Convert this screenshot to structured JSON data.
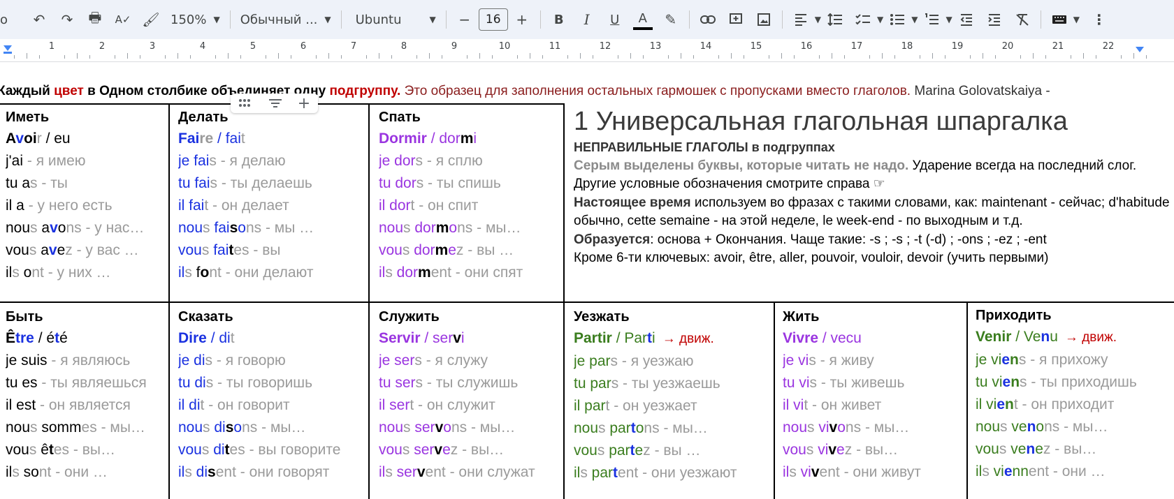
{
  "toolbar": {
    "partial_left": "o",
    "undo": "↶",
    "redo": "↷",
    "print": "🖶",
    "spell": "A✓",
    "paint": "🖌",
    "zoom": "150%",
    "style": "Обычный ...",
    "font": "Ubuntu",
    "font_size": "16",
    "minus": "−",
    "plus": "+",
    "bold": "B",
    "italic": "I",
    "underline": "U",
    "text_color": "A",
    "highlight": "✎",
    "more": "⋮"
  },
  "ruler": {
    "numbers": [
      "1",
      "2",
      "3",
      "4",
      "5",
      "6",
      "7",
      "8",
      "9",
      "10",
      "11",
      "12",
      "13",
      "14",
      "15",
      "16",
      "17",
      "18",
      "19",
      "20",
      "21",
      "22"
    ]
  },
  "headline": {
    "p1": "Каждый ",
    "p2": "цвет",
    "p3": " в Одном столбике объединяет одну ",
    "p4": "подгруппу.",
    "p5": " Это образец для заполнения остальных гармошек с пропусками вместо глаголов.",
    "p6": " Marina Golovatskaiya -"
  },
  "accent_colors": {
    "blue": "#1a31e0",
    "purple": "#9a35e0",
    "green": "#3a7d1e",
    "red": "#c00000",
    "gray": "#9a9a9a"
  },
  "verbs": {
    "avoir": {
      "title": "Иметь",
      "inf": [
        "A",
        "v",
        "oi",
        "r",
        " / eu"
      ],
      "lines": [
        [
          "j'ai",
          " - я имею"
        ],
        [
          "tu a",
          "s",
          " - ты"
        ],
        [
          "il a",
          " - у него есть"
        ],
        [
          "nou",
          "s",
          " a",
          "v",
          "o",
          "ns",
          " - у нас…"
        ],
        [
          "vou",
          "s",
          " a",
          "v",
          "e",
          "z",
          " - у вас …"
        ],
        [
          "il",
          "s",
          " o",
          "nt",
          " - у них …"
        ]
      ]
    },
    "faire": {
      "title": "Делать",
      "inf": [
        "Fai",
        "r",
        "e",
        " / fai",
        "t"
      ],
      "lines": [
        [
          "je fai",
          "s",
          " - я делаю"
        ],
        [
          "tu fai",
          "s",
          " - ты делаешь"
        ],
        [
          "il fai",
          "t",
          " - он делает"
        ],
        [
          "nou",
          "s",
          " fai",
          "s",
          "o",
          "ns",
          " - мы …"
        ],
        [
          "vou",
          "s",
          " fai",
          "t",
          "es",
          " - вы"
        ],
        [
          "il",
          "s",
          " f",
          "o",
          "nt",
          " - они делают"
        ]
      ]
    },
    "dormir": {
      "title": "Спать",
      "inf": [
        "Dormir",
        " / dor",
        "m",
        "i"
      ],
      "lines": [
        [
          "je dor",
          "s",
          " - я сплю"
        ],
        [
          "tu dor",
          "s",
          " - ты спишь"
        ],
        [
          "il dor",
          "t",
          " - он спит"
        ],
        [
          "nou",
          "s",
          " dor",
          "m",
          "o",
          "ns",
          " - мы…"
        ],
        [
          "vou",
          "s",
          " dor",
          "m",
          "e",
          "z",
          " - вы …"
        ],
        [
          "il",
          "s",
          " dor",
          "m",
          "ent",
          " - они спят"
        ]
      ]
    },
    "etre": {
      "title": "Быть",
      "inf": [
        "Ê",
        "tre",
        " / é",
        "t",
        "é"
      ],
      "lines": [
        [
          "je suis",
          " - я являюсь"
        ],
        [
          "tu es",
          " - ты являешься"
        ],
        [
          "il est",
          " - он является"
        ],
        [
          "nou",
          "s",
          " somm",
          "es",
          " - мы…"
        ],
        [
          "vou",
          "s",
          " ê",
          "t",
          "es",
          " - вы…"
        ],
        [
          "il",
          "s",
          " so",
          "nt",
          " - они …"
        ]
      ]
    },
    "dire": {
      "title": "Сказать",
      "inf": [
        "Dire",
        " / di",
        "t"
      ],
      "lines": [
        [
          "je di",
          "s",
          " - я говорю"
        ],
        [
          "tu di",
          "s",
          " - ты говоришь"
        ],
        [
          "il di",
          "t",
          " - он говорит"
        ],
        [
          "nou",
          "s",
          " di",
          "s",
          "o",
          "ns",
          " - мы…"
        ],
        [
          "vou",
          "s",
          " di",
          "t",
          "es",
          " - вы говорите"
        ],
        [
          "il",
          "s",
          " di",
          "s",
          "ent",
          " - они говорят"
        ]
      ]
    },
    "servir": {
      "title": "Служить",
      "inf": [
        "Servir",
        " / ser",
        "v",
        "i"
      ],
      "lines": [
        [
          "je ser",
          "s",
          " - я служу"
        ],
        [
          "tu ser",
          "s",
          " - ты служишь"
        ],
        [
          "il ser",
          "t",
          " - он служит"
        ],
        [
          "nou",
          "s",
          " ser",
          "v",
          "o",
          "ns",
          " - мы…"
        ],
        [
          "vou",
          "s",
          " ser",
          "v",
          "e",
          "z",
          " - вы…"
        ],
        [
          "il",
          "s",
          " ser",
          "v",
          "ent",
          " - они служат"
        ]
      ]
    },
    "partir": {
      "title": "Уезжать",
      "inf": [
        "Partir",
        " / Par",
        "t",
        "i"
      ],
      "arrow": "→ движ.",
      "lines": [
        [
          "je par",
          "s",
          " - я уезжаю"
        ],
        [
          "tu par",
          "s",
          " - ты уезжаешь"
        ],
        [
          "il par",
          "t",
          " - он уезжает"
        ],
        [
          "nou",
          "s",
          " par",
          "t",
          "o",
          "ns",
          " - мы…"
        ],
        [
          "vou",
          "s",
          " par",
          "t",
          "e",
          "z",
          " - вы …"
        ],
        [
          "il",
          "s",
          " par",
          "t",
          "ent",
          " - они уезжают"
        ]
      ]
    },
    "vivre": {
      "title": "Жить",
      "inf": [
        "Vivre",
        " / vecu"
      ],
      "lines": [
        [
          "je vi",
          "s",
          " - я живу"
        ],
        [
          "tu vi",
          "s",
          " - ты живешь"
        ],
        [
          "il vi",
          "t",
          " - он живет"
        ],
        [
          "nou",
          "s",
          " vi",
          "v",
          "o",
          "ns",
          " - мы…"
        ],
        [
          "vou",
          "s",
          " vi",
          "v",
          "e",
          "z",
          " - вы…"
        ],
        [
          "il",
          "s",
          " vi",
          "v",
          "ent",
          " - они живут"
        ]
      ]
    },
    "venir": {
      "title": "Приходить",
      "inf": [
        "Venir",
        " / Ve",
        "n",
        "u"
      ],
      "arrow": "→ движ.",
      "lines": [
        [
          "je vi",
          "e",
          "n",
          "s",
          " - я прихожу"
        ],
        [
          "tu vi",
          "e",
          "n",
          "s",
          " - ты приходишь"
        ],
        [
          "il vi",
          "e",
          "n",
          "t",
          " - он приходит"
        ],
        [
          "nou",
          "s",
          " ve",
          "n",
          "o",
          "ns",
          " - мы…"
        ],
        [
          "vou",
          "s",
          " ve",
          "n",
          "e",
          "z",
          " - вы…"
        ],
        [
          "il",
          "s",
          " vi",
          "e",
          "nn",
          "ent",
          " - они …"
        ]
      ]
    }
  },
  "info": {
    "heading": "1  Универсальная глагольная шпаргалка",
    "sub": "НЕПРАВИЛЬНЫЕ ГЛАГОЛЫ в подгруппах",
    "gray_bold": "Серым выделены буквы, которые читать не надо.",
    "rest1": " Ударение всегда на последний слог. Другие условные обозначения смотрите справа ☞",
    "now_bold": "Настоящее время",
    "now_rest": " используем во фразах с такими словами, как: maintenant - сейчас; d'habitude обычно, cette semaine - на этой неделе, le week-end - по выходным и т.д.",
    "form_bold": "Образуется",
    "form_rest": ": основа + Окончания. Чаще такие: -s ; -s ; -t (-d) ; -ons ; -ez ; -ent",
    "key": "Кроме 6-ти ключевых: avoir, être, aller, pouvoir, vouloir, devoir (учить первыми)"
  }
}
